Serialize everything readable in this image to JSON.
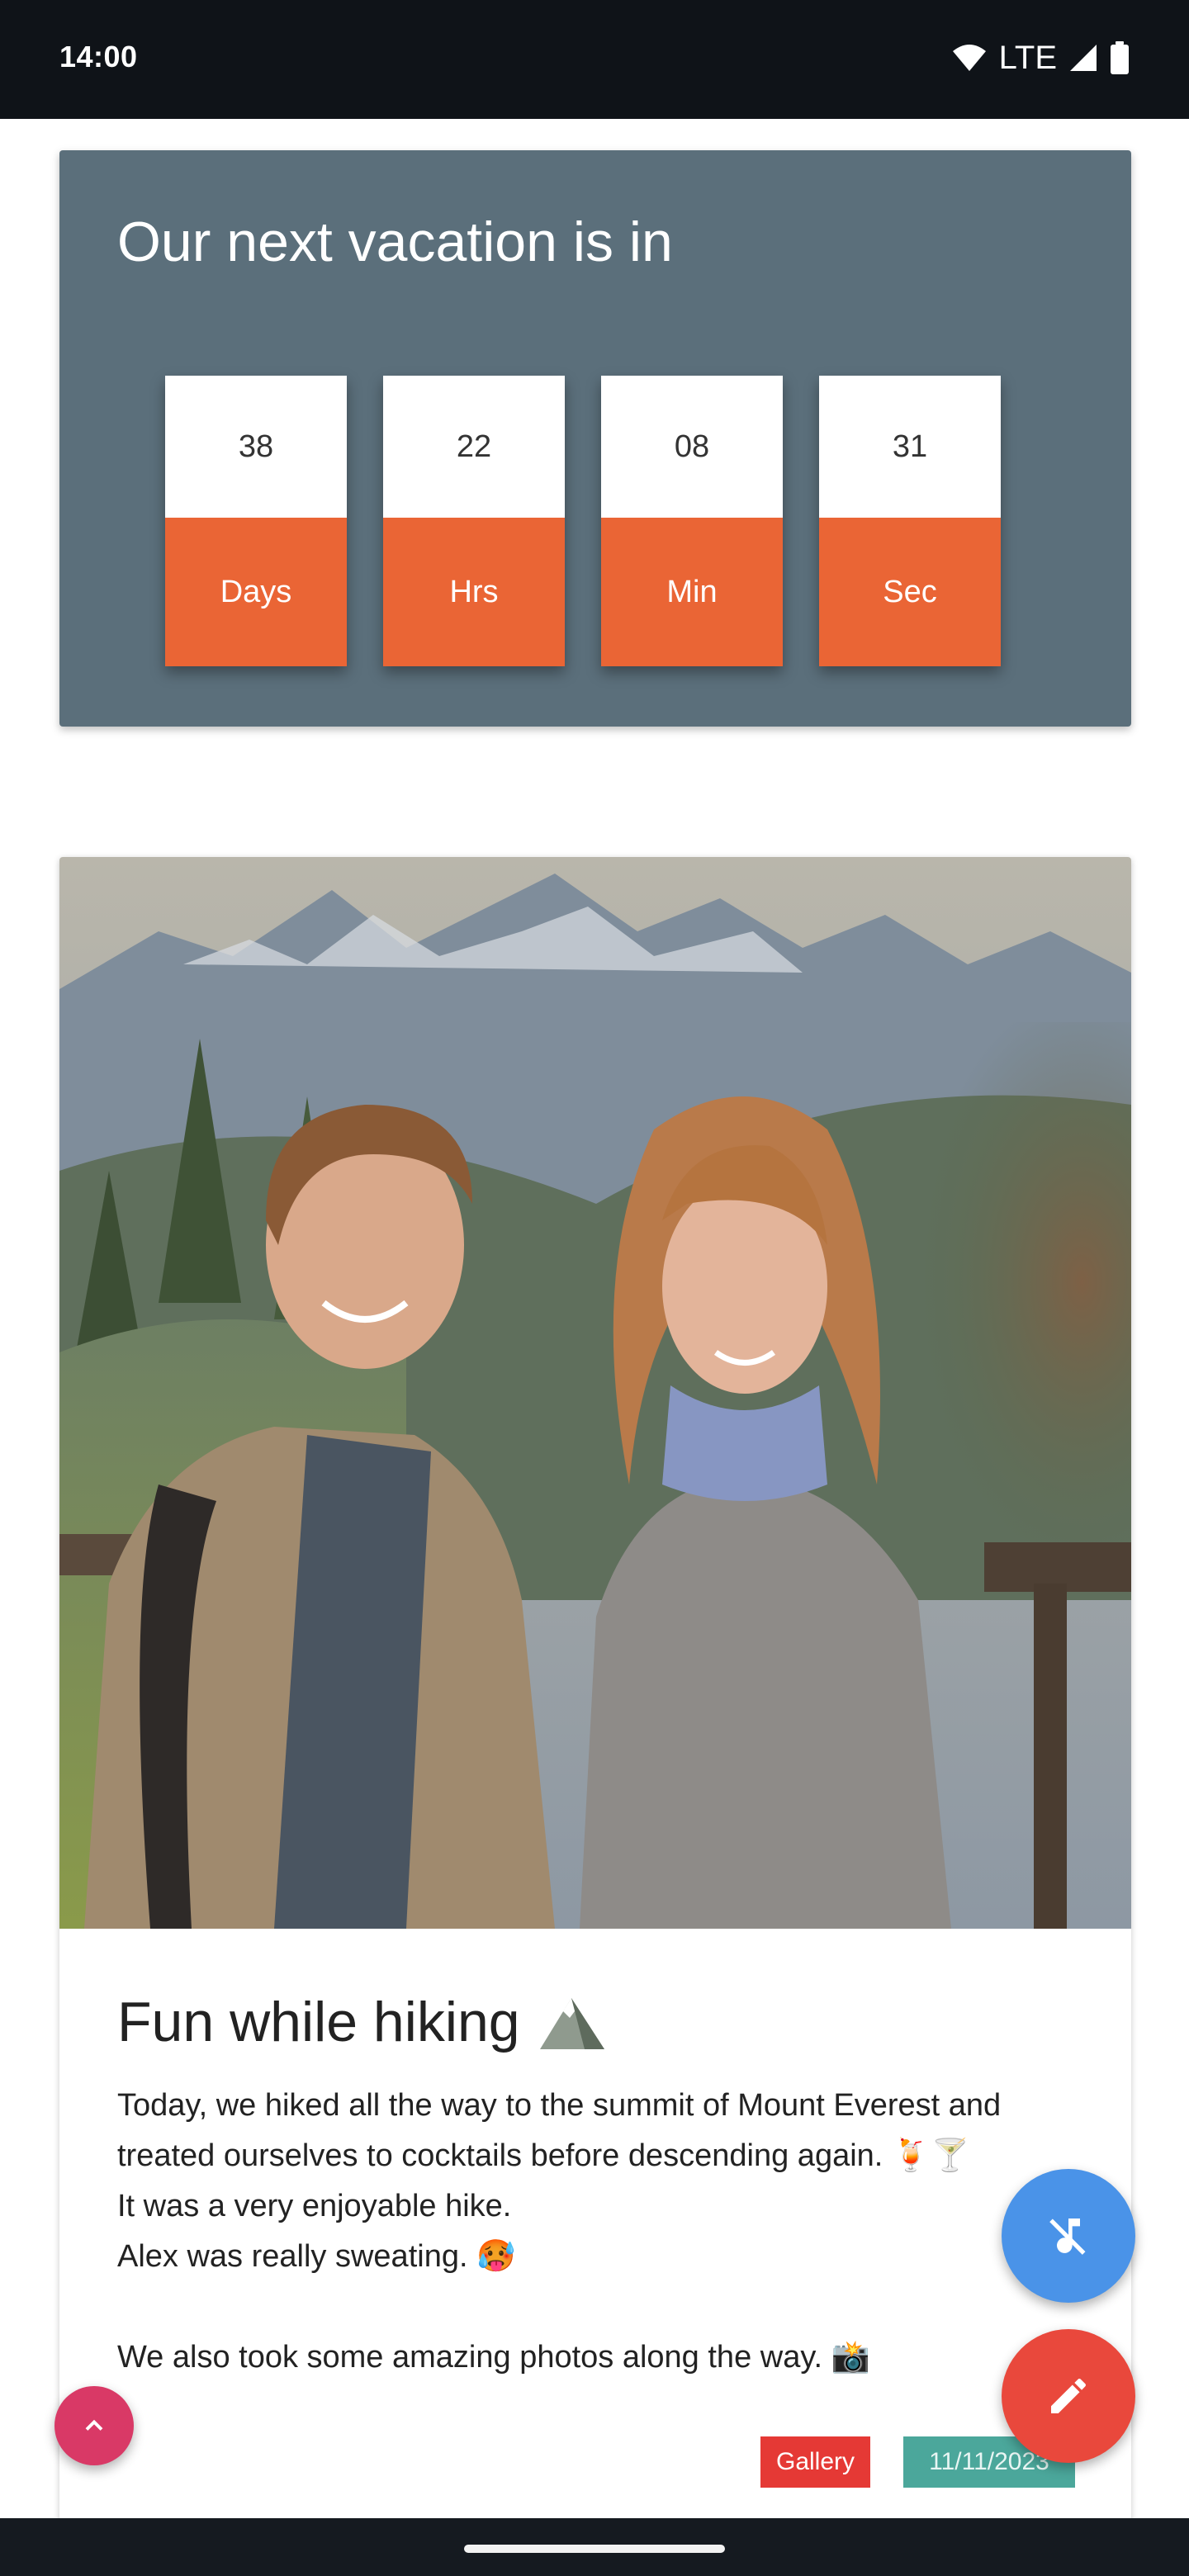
{
  "status_bar": {
    "time": "14:00",
    "network": "LTE",
    "icons": [
      "wifi-icon",
      "cell-signal-icon",
      "battery-icon"
    ]
  },
  "countdown": {
    "title": "Our next vacation is in",
    "units": [
      {
        "value": "38",
        "label": "Days"
      },
      {
        "value": "22",
        "label": "Hrs"
      },
      {
        "value": "08",
        "label": "Min"
      },
      {
        "value": "31",
        "label": "Sec"
      }
    ],
    "colors": {
      "card": "#5b6f7b",
      "label_bg": "#ea6535"
    }
  },
  "post": {
    "image": "couple-hiking-mountains-photo",
    "title": "Fun while hiking",
    "title_icon": "mountain-emoji",
    "body_lines": [
      "Today, we hiked all the way to the summit of Mount Everest and",
      "treated ourselves to cocktails before descending again. 🍹🍸",
      "It was a very enjoyable hike.",
      "Alex was really sweating. 🥵",
      "",
      "We also took some amazing photos along the way. 📸"
    ],
    "tags": {
      "gallery": "Gallery",
      "date": "11/11/2023"
    }
  },
  "fabs": {
    "music_off": "music-off-icon",
    "edit": "pencil-icon",
    "scroll_top": "chevron-up-icon"
  }
}
